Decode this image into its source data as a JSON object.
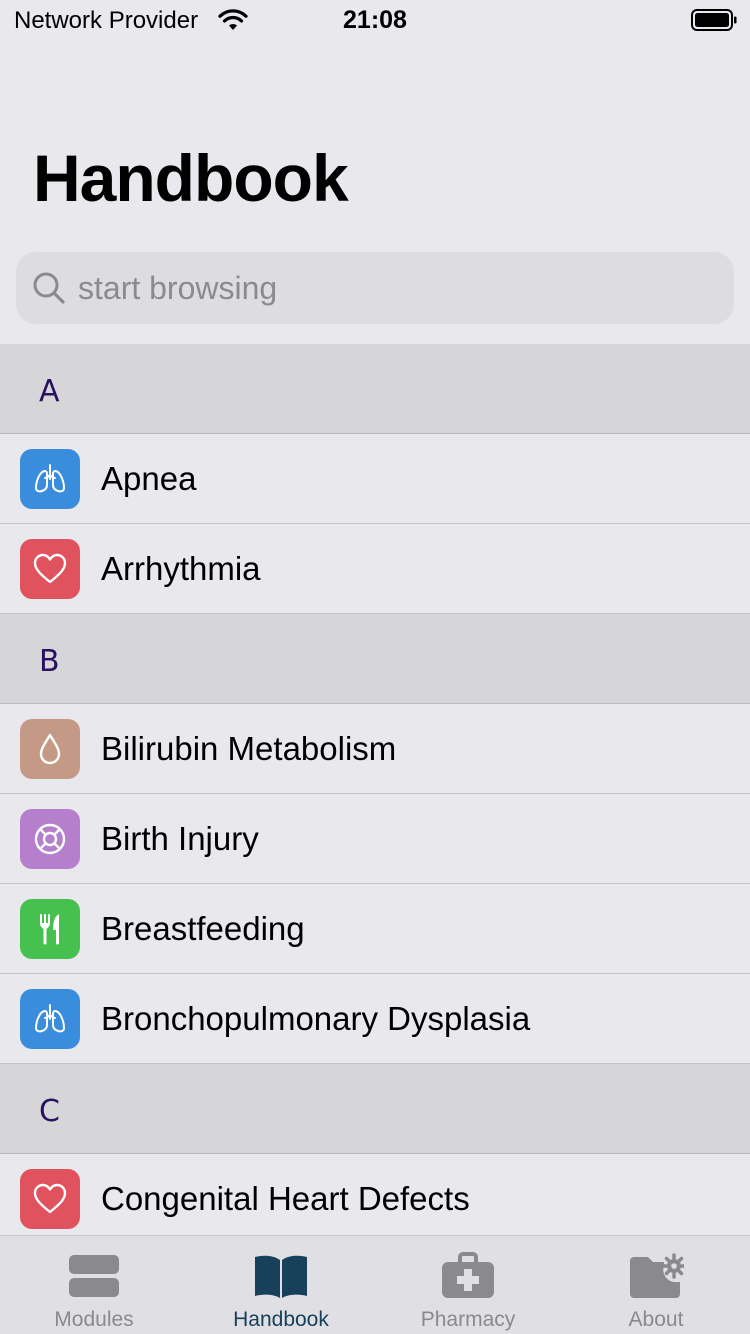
{
  "status_bar": {
    "carrier": "Network Provider",
    "time": "21:08"
  },
  "title": "Handbook",
  "search": {
    "placeholder": "start browsing",
    "value": ""
  },
  "sections": [
    {
      "letter": "A",
      "items": [
        {
          "label": "Apnea",
          "icon": "lungs-icon",
          "color": "#3a8ddd"
        },
        {
          "label": "Arrhythmia",
          "icon": "heart-icon",
          "color": "#e0525d"
        }
      ]
    },
    {
      "letter": "B",
      "items": [
        {
          "label": "Bilirubin Metabolism",
          "icon": "drop-icon",
          "color": "#c49a86"
        },
        {
          "label": "Birth Injury",
          "icon": "lifebuoy-icon",
          "color": "#b57fce"
        },
        {
          "label": "Breastfeeding",
          "icon": "fork-knife-icon",
          "color": "#46c04f"
        },
        {
          "label": "Bronchopulmonary Dysplasia",
          "icon": "lungs-icon",
          "color": "#3a8ddd"
        }
      ]
    },
    {
      "letter": "C",
      "items": [
        {
          "label": "Congenital Heart Defects",
          "icon": "heart-icon",
          "color": "#e0525d"
        }
      ]
    }
  ],
  "tabs": [
    {
      "label": "Modules",
      "icon": "modules-icon",
      "active": false
    },
    {
      "label": "Handbook",
      "icon": "book-icon",
      "active": true
    },
    {
      "label": "Pharmacy",
      "icon": "medkit-icon",
      "active": false
    },
    {
      "label": "About",
      "icon": "folder-gear-icon",
      "active": false
    }
  ],
  "colors": {
    "accent": "#17405a",
    "section_letter": "#2a1060",
    "background": "#e9e8ed"
  }
}
